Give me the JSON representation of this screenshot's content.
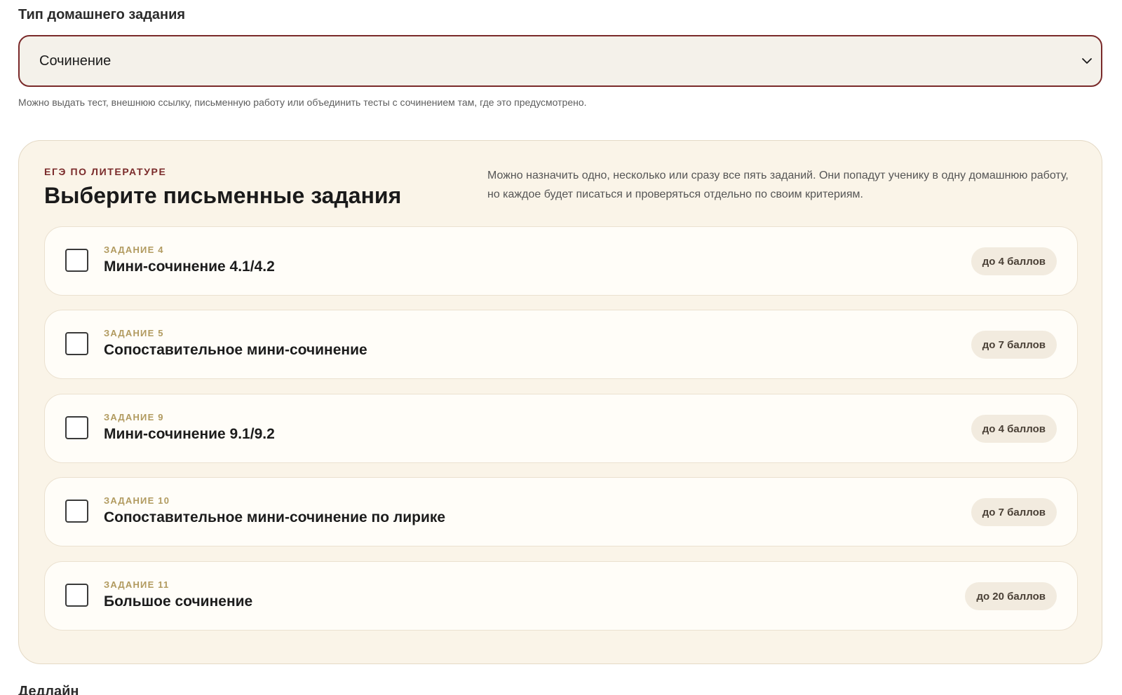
{
  "form": {
    "homework_type_label": "Тип домашнего задания",
    "homework_type_value": "Сочинение",
    "homework_type_hint": "Можно выдать тест, внешнюю ссылку, письменную работу или объединить тесты с сочинением там, где это предусмотрено.",
    "next_field_label": "Дедлайн"
  },
  "panel": {
    "eyebrow": "ЕГЭ ПО ЛИТЕРАТУРЕ",
    "title": "Выберите письменные задания",
    "description": "Можно назначить одно, несколько или сразу все пять заданий. Они попадут ученику в одну домашнюю работу, но каждое будет писаться и проверяться отдельно по своим критериям.",
    "tasks": [
      {
        "number": "ЗАДАНИЕ 4",
        "title": "Мини-сочинение 4.1/4.2",
        "points": "до 4 баллов",
        "checked": false
      },
      {
        "number": "ЗАДАНИЕ 5",
        "title": "Сопоставительное мини-сочинение",
        "points": "до 7 баллов",
        "checked": false
      },
      {
        "number": "ЗАДАНИЕ 9",
        "title": "Мини-сочинение 9.1/9.2",
        "points": "до 4 баллов",
        "checked": false
      },
      {
        "number": "ЗАДАНИЕ 10",
        "title": "Сопоставительное мини-сочинение по лирике",
        "points": "до 7 баллов",
        "checked": false
      },
      {
        "number": "ЗАДАНИЕ 11",
        "title": "Большое сочинение",
        "points": "до 20 баллов",
        "checked": false
      }
    ]
  },
  "colors": {
    "accent": "#7a2a2a",
    "panel_bg": "#faf4e8",
    "task_number": "#b19a5f",
    "badge_bg": "#f2ebdf"
  }
}
